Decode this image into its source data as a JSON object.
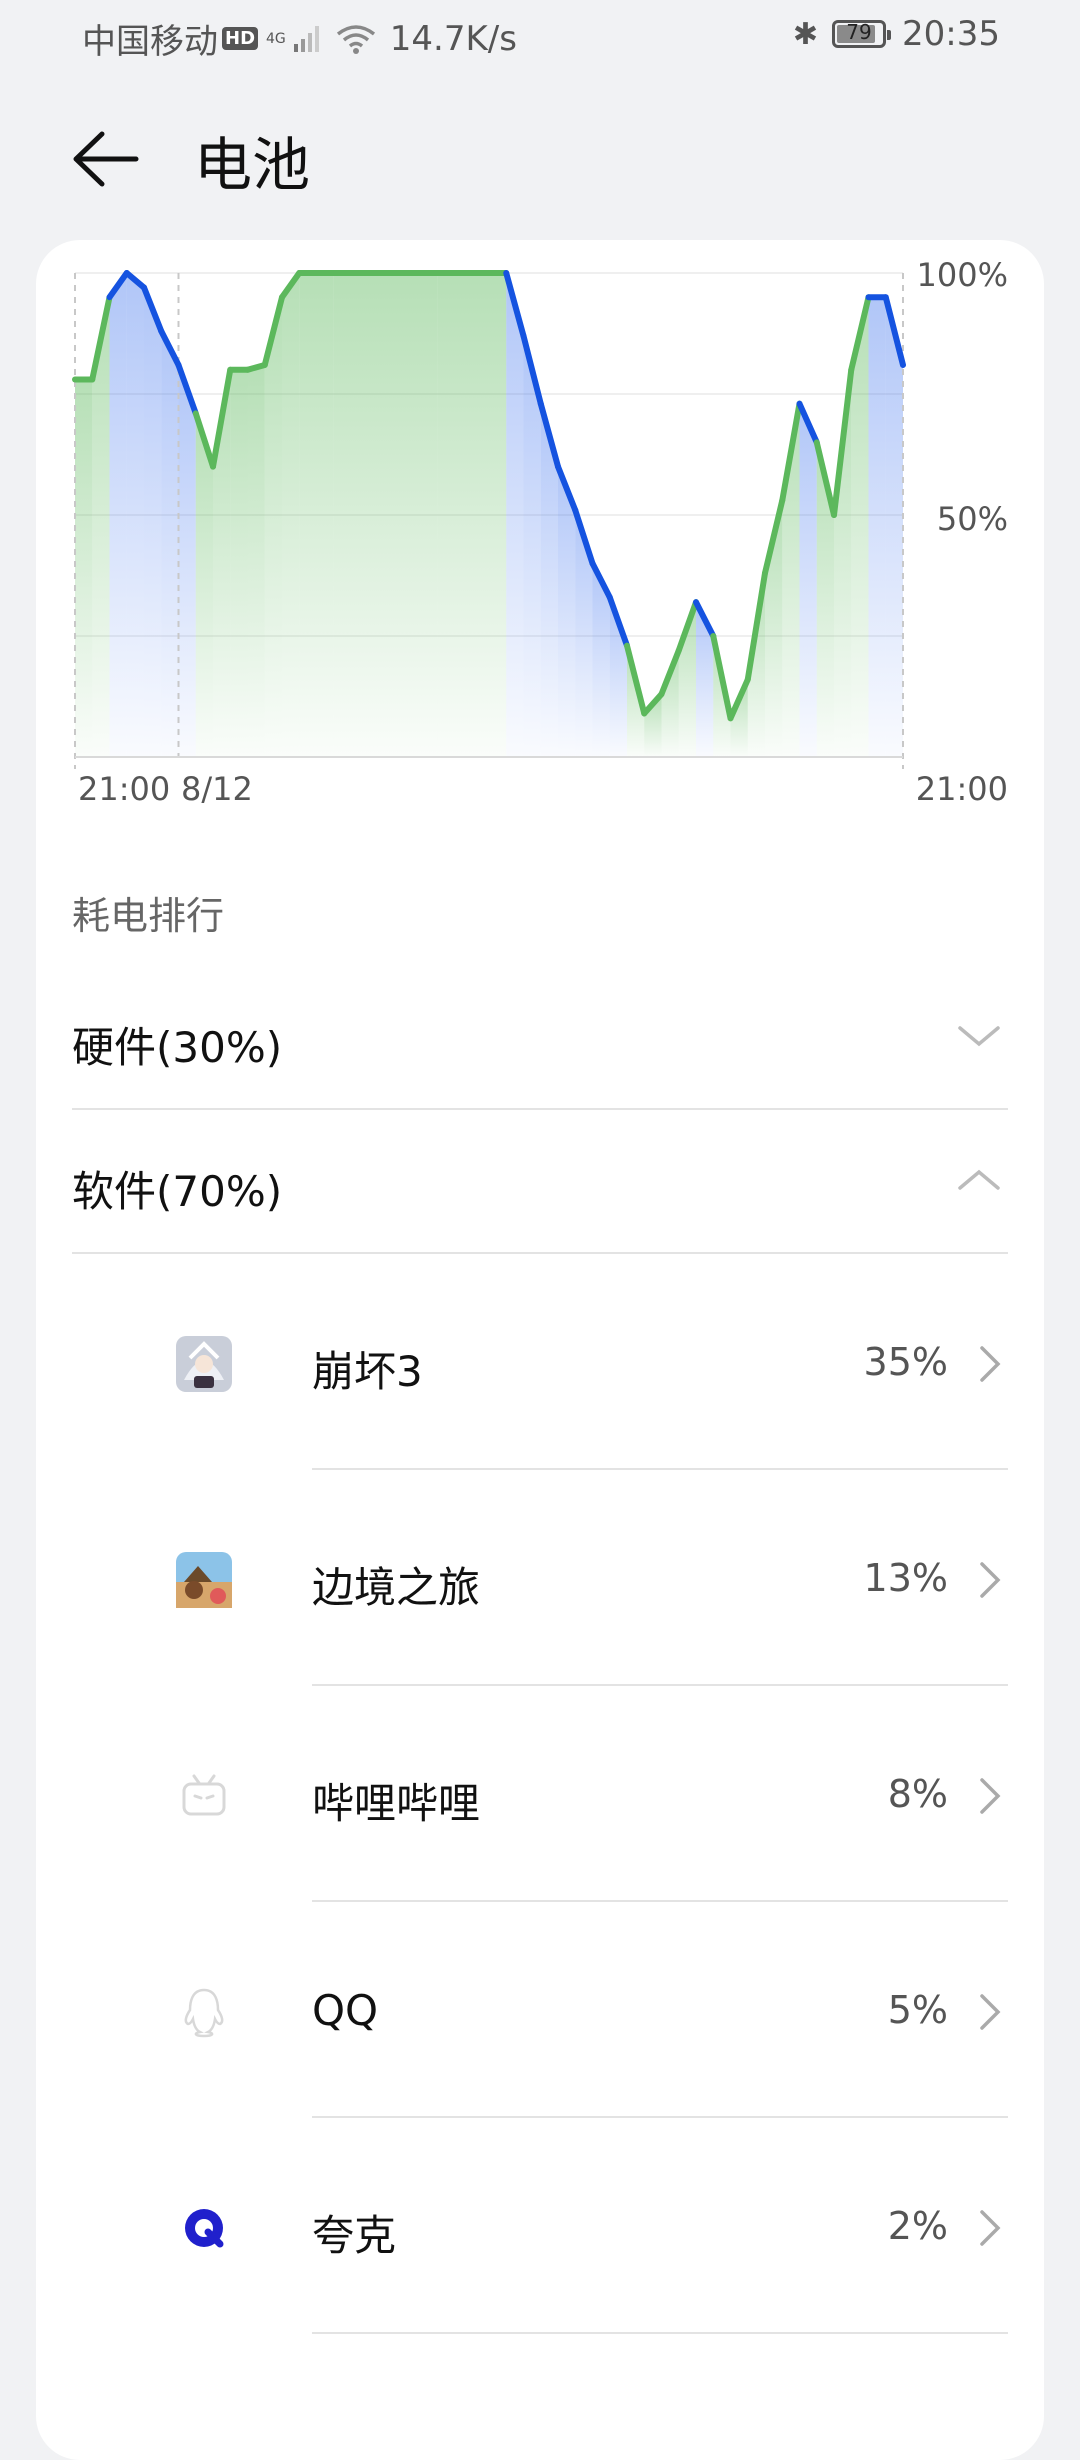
{
  "status_bar": {
    "carrier": "中国移动",
    "hd": "HD",
    "network": "4G",
    "speed": "14.7K/s",
    "battery": "79",
    "time": "20:35"
  },
  "header": {
    "title": "电池"
  },
  "chart_data": {
    "type": "area",
    "y_ticks": [
      "100%",
      "50%"
    ],
    "x_ticks": [
      "21:00",
      "8/12",
      "21:00"
    ],
    "ylim": [
      0,
      100
    ],
    "colors": {
      "charging": "#5cb85c",
      "discharging": "#1553e0"
    },
    "points": [
      [
        0,
        78,
        "c"
      ],
      [
        2,
        78,
        "c"
      ],
      [
        4,
        95,
        "c"
      ],
      [
        6,
        100,
        "d"
      ],
      [
        8,
        97,
        "d"
      ],
      [
        10,
        88,
        "d"
      ],
      [
        12,
        81,
        "d"
      ],
      [
        14,
        71,
        "d"
      ],
      [
        16,
        60,
        "c"
      ],
      [
        18,
        80,
        "c"
      ],
      [
        20,
        80,
        "c"
      ],
      [
        22,
        81,
        "c"
      ],
      [
        24,
        95,
        "c"
      ],
      [
        26,
        100,
        "c"
      ],
      [
        30,
        100,
        "c"
      ],
      [
        36,
        100,
        "c"
      ],
      [
        42,
        100,
        "c"
      ],
      [
        48,
        100,
        "c"
      ],
      [
        50,
        100,
        "c"
      ],
      [
        52,
        87,
        "d"
      ],
      [
        54,
        73,
        "d"
      ],
      [
        56,
        60,
        "d"
      ],
      [
        58,
        51,
        "d"
      ],
      [
        60,
        40,
        "d"
      ],
      [
        62,
        33,
        "d"
      ],
      [
        64,
        23,
        "d"
      ],
      [
        66,
        9,
        "c"
      ],
      [
        68,
        13,
        "c"
      ],
      [
        70,
        22,
        "c"
      ],
      [
        72,
        32,
        "c"
      ],
      [
        74,
        25,
        "d"
      ],
      [
        76,
        8,
        "c"
      ],
      [
        78,
        16,
        "c"
      ],
      [
        80,
        38,
        "c"
      ],
      [
        82,
        53,
        "c"
      ],
      [
        84,
        73,
        "c"
      ],
      [
        86,
        65,
        "d"
      ],
      [
        88,
        50,
        "c"
      ],
      [
        90,
        80,
        "c"
      ],
      [
        92,
        95,
        "c"
      ],
      [
        94,
        95,
        "d"
      ],
      [
        96,
        81,
        "d"
      ]
    ]
  },
  "ranking": {
    "label": "耗电排行",
    "hardware": "硬件(30%)",
    "software": "软件(70%)",
    "apps": [
      {
        "name": "崩坏3",
        "percent": "35%",
        "icon": "honkai-impact-icon"
      },
      {
        "name": "边境之旅",
        "percent": "13%",
        "icon": "frontier-journey-icon"
      },
      {
        "name": "哔哩哔哩",
        "percent": "8%",
        "icon": "bilibili-icon"
      },
      {
        "name": "QQ",
        "percent": "5%",
        "icon": "qq-penguin-icon"
      },
      {
        "name": "夸克",
        "percent": "2%",
        "icon": "quark-icon"
      }
    ]
  }
}
